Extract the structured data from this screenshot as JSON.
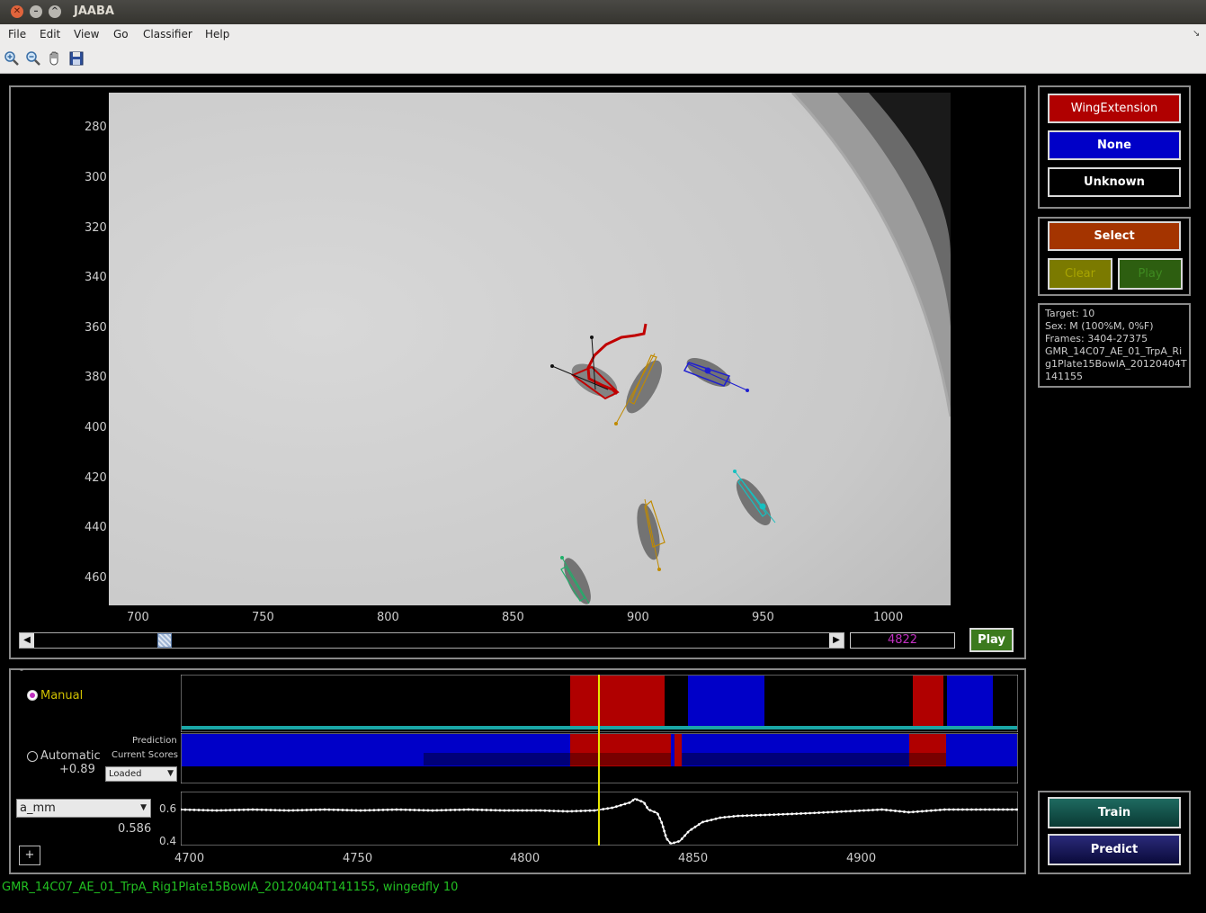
{
  "window": {
    "title": "JAABA"
  },
  "menu": [
    "File",
    "Edit",
    "View",
    "Go",
    "Classifier",
    "Help"
  ],
  "toolbar": {
    "icons": [
      "zoom-in-icon",
      "zoom-out-icon",
      "pan-hand-icon",
      "save-icon"
    ]
  },
  "video": {
    "y_ticks": [
      "280",
      "300",
      "320",
      "340",
      "360",
      "380",
      "400",
      "420",
      "440",
      "460"
    ],
    "x_ticks": [
      "700",
      "750",
      "800",
      "850",
      "900",
      "950",
      "1000"
    ],
    "frame": "4822",
    "play_label": "Play"
  },
  "labels": {
    "behavior": "WingExtension",
    "none": "None",
    "unknown": "Unknown",
    "select": "Select",
    "clear": "Clear",
    "play": "Play"
  },
  "info": {
    "target": "Target: 10",
    "sex": "Sex: M (100%M, 0%F)",
    "frames": "Frames: 3404-27375",
    "experiment_1": "GMR_14C07_AE_01_TrpA_Ri",
    "experiment_2": "g1Plate15BowlA_20120404T",
    "experiment_3": "141155"
  },
  "timeline": {
    "manual_label": "Manual",
    "automatic_label": "Automatic",
    "score": "+0.89",
    "prediction_label": "Prediction",
    "current_scores_label": "Current Scores",
    "scores_select": "Loaded",
    "feature_select": "a_mm",
    "feature_value": "0.586",
    "y_ticks": [
      "0.6",
      "0.4"
    ],
    "x_ticks": [
      "4700",
      "4750",
      "4800",
      "4850",
      "4900"
    ],
    "plus_label": "+",
    "collapse_label": "-"
  },
  "classifier": {
    "train": "Train",
    "predict": "Predict"
  },
  "status": {
    "text": "GMR_14C07_AE_01_TrpA_Rig1Plate15BowlA_20120404T141155, wingedfly 10"
  },
  "colors": {
    "behavior": "#b00000",
    "none": "#0000c8",
    "unknown": "#000000",
    "select": "#a43400",
    "status_text": "#22c022",
    "feature_trace": "#ffffff",
    "current_frame": "#e6e600"
  }
}
